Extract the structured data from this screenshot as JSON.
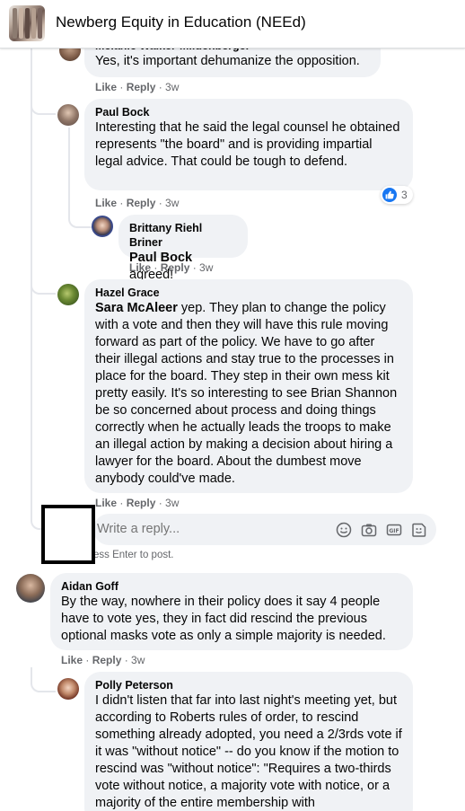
{
  "header": {
    "group_name": "Newberg Equity in Education (NEEd)"
  },
  "comments": {
    "c0": {
      "author": "Melanie Walker-Mildenberger",
      "text": "Yes, it's important dehumanize the opposition.",
      "like": "Like",
      "reply": "Reply",
      "time": "3w"
    },
    "c1": {
      "author": "Paul Bock",
      "text": "Interesting that he said the legal counsel he obtained represents \"the board\" and is providing impartial legal advice. That could be tough to defend.",
      "like": "Like",
      "reply": "Reply",
      "time": "3w",
      "reaction_count": "3"
    },
    "c2": {
      "author": "Brittany Riehl Briner",
      "mention": "Paul Bock",
      "text": " agreed!",
      "like": "Like",
      "reply": "Reply",
      "time": "3w"
    },
    "c3": {
      "author": "Hazel Grace",
      "mention": "Sara McAleer",
      "text": " yep. They plan to change the policy with a vote and then they will have this rule moving forward as part of the policy. We have to go after their illegal actions and stay true to the processes in place for the board. They step in their own mess kit pretty easily. It's so interesting to see Brian Shannon be so concerned about process and doing things correctly when he actually leads the troops to make an illegal action by making a decision about hiring a lawyer for the board. About the dumbest move anybody could've made.",
      "like": "Like",
      "reply": "Reply",
      "time": "3w"
    },
    "reply_box": {
      "placeholder": "Write a reply...",
      "hint": "ess Enter to post."
    },
    "c4": {
      "author": "Aidan Goff",
      "text": "By the way, nowhere in their policy does it say 4 people have to vote yes, they in fact did rescind the previous optional masks vote as only a simple majority is needed.",
      "like": "Like",
      "reply": "Reply",
      "time": "3w"
    },
    "c5": {
      "author": "Polly Peterson",
      "text": "I didn't listen that far into last night's meeting yet, but according to Roberts rules of order, to rescind something already adopted, you need a 2/3rds vote if it was \"without notice\" -- do you know if the motion to rescind was \"without notice\": \"Requires a two-thirds vote without notice, a majority vote with notice, or a majority of the entire membership with"
    }
  },
  "icons": [
    "emoji-icon",
    "camera-icon",
    "gif-icon",
    "sticker-icon",
    "like-reaction-icon"
  ],
  "colors": {
    "bubble": "#f0f2f5",
    "meta": "#65676b",
    "like_blue": "#1877f2"
  }
}
